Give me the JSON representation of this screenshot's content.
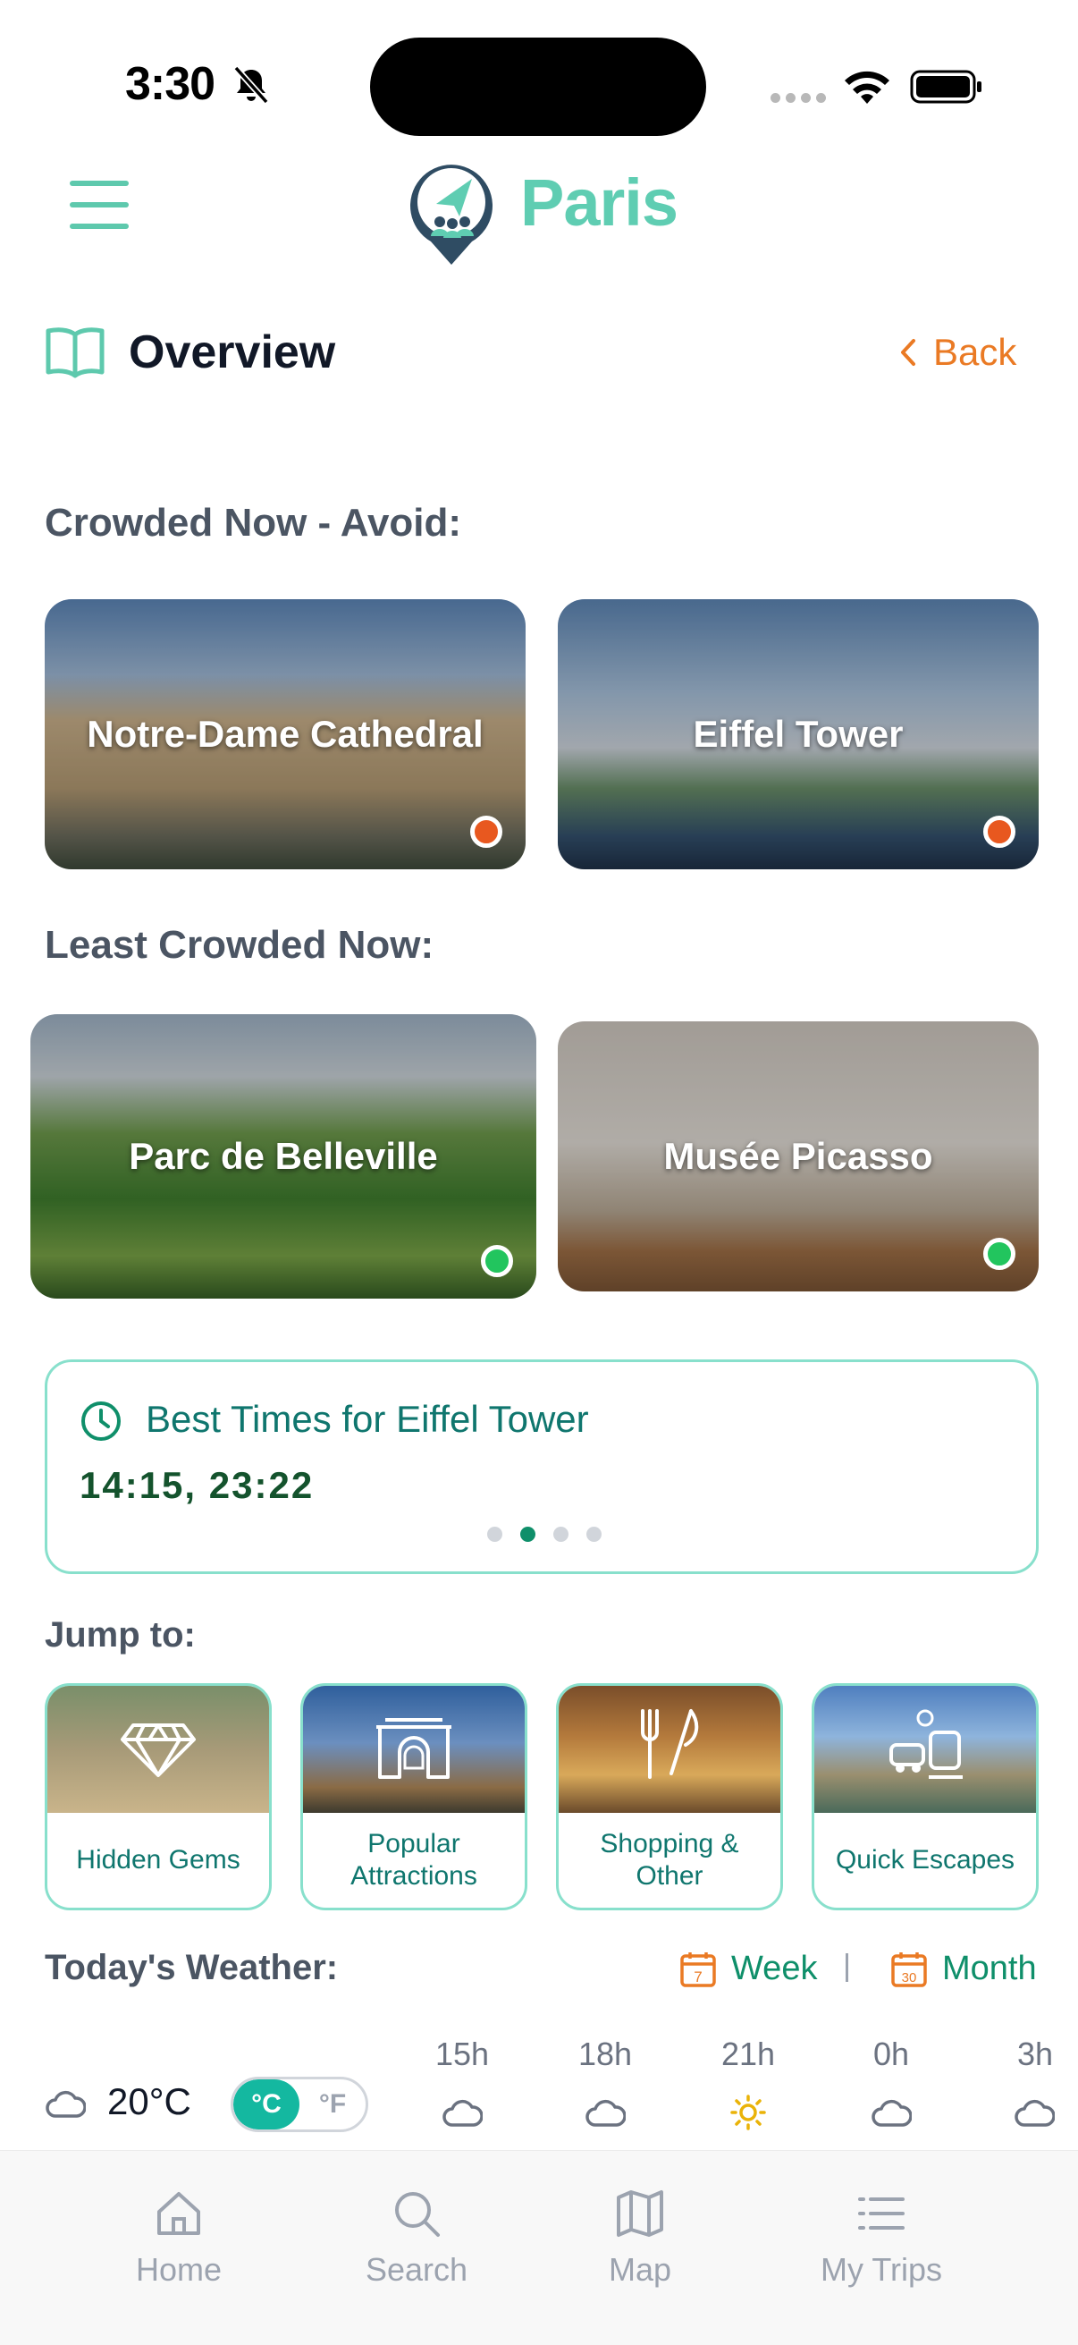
{
  "status_bar": {
    "time": "3:30"
  },
  "header": {
    "title": "Paris"
  },
  "overview": {
    "title": "Overview",
    "back_label": "Back"
  },
  "crowded": {
    "heading": "Crowded Now - Avoid:",
    "cards": [
      {
        "name": "Notre-Dame Cathedral",
        "status": "crowded"
      },
      {
        "name": "Eiffel Tower",
        "status": "crowded"
      }
    ]
  },
  "least_crowded": {
    "heading": "Least Crowded Now:",
    "cards": [
      {
        "name": "Parc de Belleville",
        "status": "quiet"
      },
      {
        "name": "Musée Picasso",
        "status": "quiet"
      }
    ]
  },
  "best_times": {
    "title": "Best Times for Eiffel Tower",
    "times": "14:15, 23:22",
    "page_count": 4,
    "active_page": 2
  },
  "jump_to": {
    "heading": "Jump to:",
    "tiles": [
      {
        "label": "Hidden Gems",
        "icon": "diamond-icon"
      },
      {
        "label": "Popular Attractions",
        "icon": "landmark-icon"
      },
      {
        "label": "Shopping & Other",
        "icon": "shopping-dining-icon"
      },
      {
        "label": "Quick Escapes",
        "icon": "train-car-icon"
      }
    ]
  },
  "weather": {
    "heading": "Today's Weather:",
    "week_label": "Week",
    "month_label": "Month",
    "calendar_day_week": "7",
    "calendar_day_month": "30",
    "current_temp": "20°C",
    "unit_c": "°C",
    "unit_f": "°F",
    "selected_unit": "°C",
    "hours": [
      {
        "label": "15h",
        "icon": "cloud-icon"
      },
      {
        "label": "18h",
        "icon": "cloud-icon"
      },
      {
        "label": "21h",
        "icon": "sun-icon"
      },
      {
        "label": "0h",
        "icon": "cloud-icon"
      },
      {
        "label": "3h",
        "icon": "cloud-icon"
      }
    ]
  },
  "tabbar": {
    "tabs": [
      {
        "label": "Home",
        "icon": "home-icon"
      },
      {
        "label": "Search",
        "icon": "search-icon"
      },
      {
        "label": "Map",
        "icon": "map-icon"
      },
      {
        "label": "My Trips",
        "icon": "list-icon"
      }
    ]
  },
  "colors": {
    "brand_teal": "#5fcdb2",
    "accent_orange": "#ea7a24",
    "crowded_dot": "#e8581f",
    "quiet_dot": "#22c55e",
    "dark_green": "#0f8f6a"
  }
}
